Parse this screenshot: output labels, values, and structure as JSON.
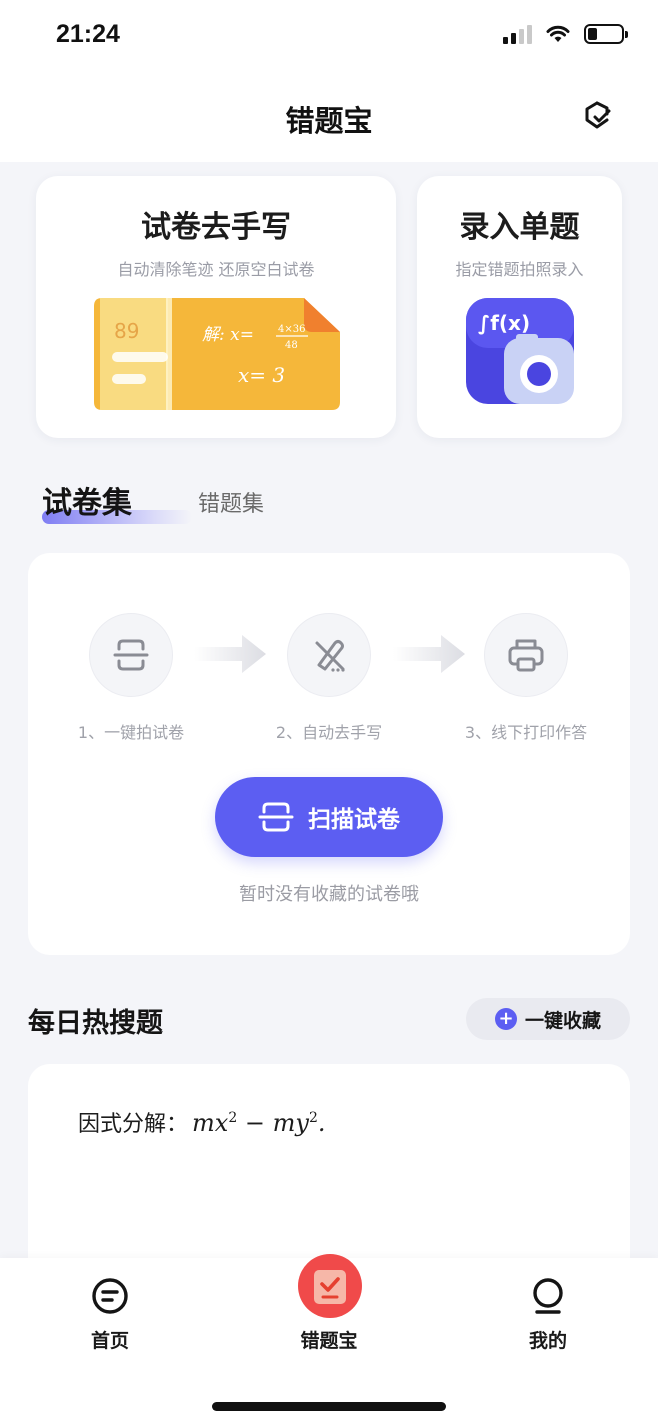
{
  "status": {
    "time": "21:24"
  },
  "header": {
    "title": "错题宝"
  },
  "cards": {
    "exam": {
      "title": "试卷去手写",
      "subtitle": "自动清除笔迹 还原空白试卷",
      "sheet_text": "解: x=",
      "fraction_num": "4×36",
      "fraction_den": "48",
      "answer": "x= 3",
      "corner_number": "89"
    },
    "single": {
      "title": "录入单题",
      "subtitle": "指定错题拍照录入",
      "formula": "∫f(x)"
    }
  },
  "tabs": {
    "active": "试卷集",
    "inactive": "错题集"
  },
  "steps": [
    {
      "label": "1、一键拍试卷"
    },
    {
      "label": "2、自动去手写"
    },
    {
      "label": "3、线下打印作答"
    }
  ],
  "scan": {
    "button_label": "扫描试卷",
    "empty_hint": "暂时没有收藏的试卷哦"
  },
  "hot": {
    "title": "每日热搜题",
    "collect_label": "一键收藏",
    "plus_symbol": "+"
  },
  "question": {
    "prefix": "因式分解：",
    "term1": "mx",
    "minus": " − ",
    "term2": "my",
    "exp": "2",
    "period": "."
  },
  "tabbar": {
    "items": [
      {
        "label": "首页"
      },
      {
        "label": "错题宝"
      },
      {
        "label": "我的"
      }
    ]
  },
  "colors": {
    "accent": "#5c5ef2",
    "badge": "#f04a4a",
    "exam_yellow": "#f5b73a"
  }
}
